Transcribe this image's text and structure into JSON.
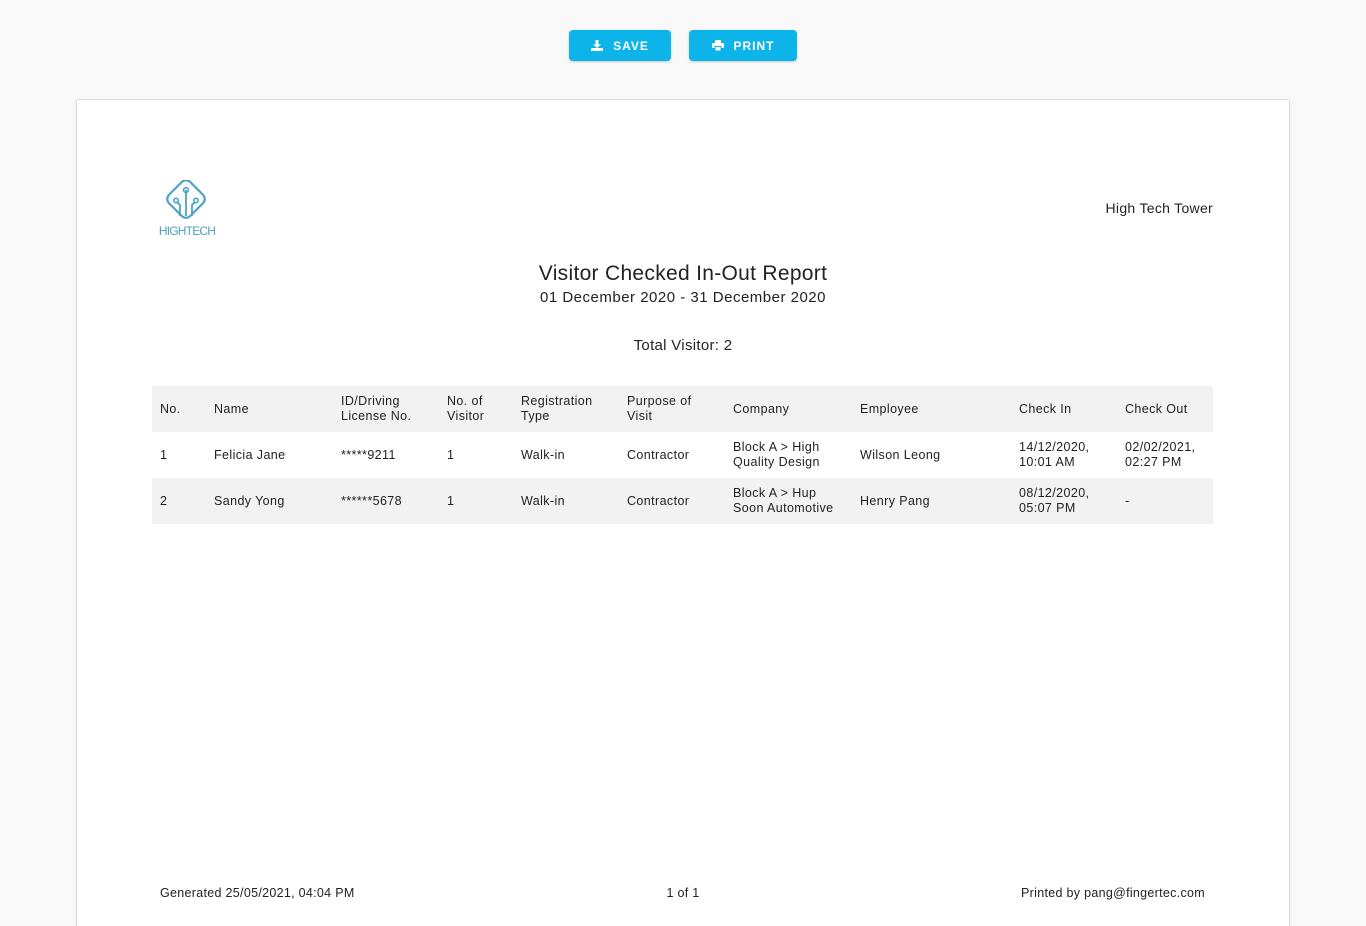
{
  "toolbar": {
    "save_label": "SAVE",
    "print_label": "PRINT",
    "accent": "#0db4ea"
  },
  "report": {
    "logo_text": "HIGHTECH",
    "building": "High Tech Tower",
    "title": "Visitor Checked In-Out Report",
    "date_range": "01 December 2020 - 31 December 2020",
    "total_visitor": "Total Visitor: 2"
  },
  "table": {
    "headers": {
      "no": "No.",
      "name": "Name",
      "id_line1": "ID/Driving",
      "id_line2": "License No.",
      "visitors_line1": "No. of",
      "visitors_line2": "Visitor",
      "reg_line1": "Registration",
      "reg_line2": "Type",
      "purpose_line1": "Purpose of",
      "purpose_line2": "Visit",
      "company": "Company",
      "employee": "Employee",
      "check_in": "Check In",
      "check_out": "Check Out"
    },
    "rows": [
      {
        "no": "1",
        "name": "Felicia Jane",
        "id": "*****9211",
        "visitors": "1",
        "reg_type": "Walk-in",
        "purpose": "Contractor",
        "company_line1": "Block A > High",
        "company_line2": "Quality Design",
        "employee": "Wilson Leong",
        "check_in_line1": "14/12/2020,",
        "check_in_line2": "10:01 AM",
        "check_out_line1": "02/02/2021,",
        "check_out_line2": "02:27 PM"
      },
      {
        "no": "2",
        "name": "Sandy Yong",
        "id": "******5678",
        "visitors": "1",
        "reg_type": "Walk-in",
        "purpose": "Contractor",
        "company_line1": "Block A > Hup",
        "company_line2": "Soon Automotive",
        "employee": "Henry Pang",
        "check_in_line1": "08/12/2020,",
        "check_in_line2": "05:07 PM",
        "check_out_line1": "-",
        "check_out_line2": ""
      }
    ]
  },
  "footer": {
    "generated": "Generated 25/05/2021, 04:04 PM",
    "page": "1 of 1",
    "printed_by": "Printed by pang@fingertec.com"
  }
}
